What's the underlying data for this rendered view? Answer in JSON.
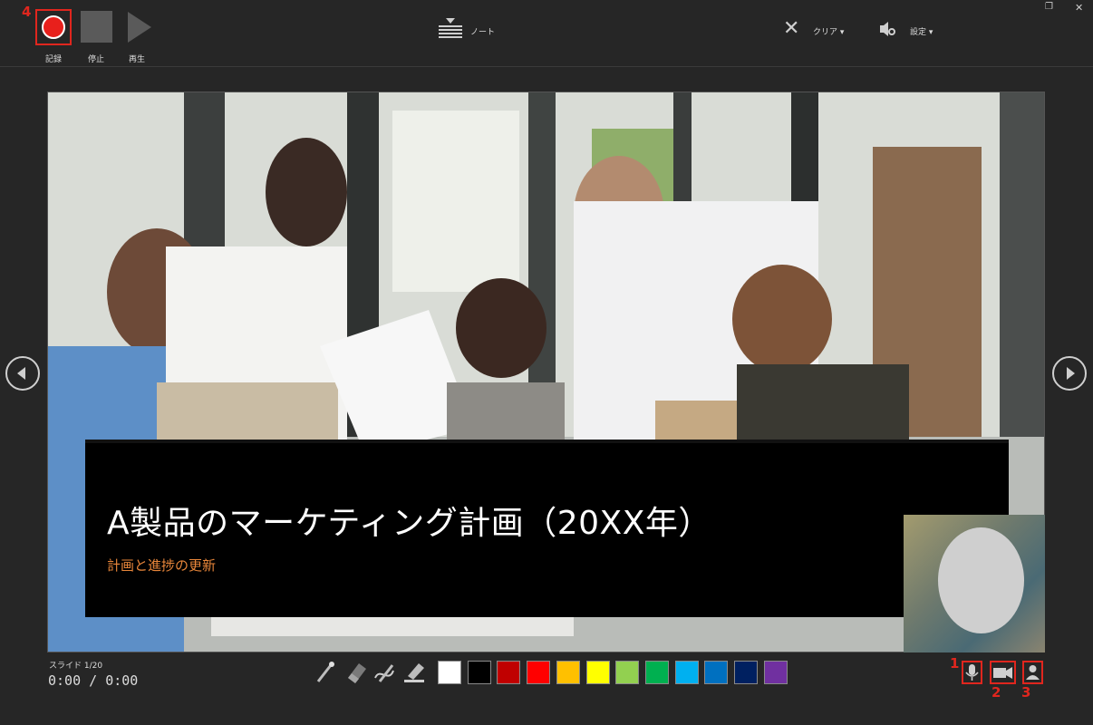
{
  "window": {
    "minimize_glyph": "▔",
    "maximize_glyph": "❐",
    "close_glyph": "✕"
  },
  "toolbar": {
    "record_label": "記録",
    "stop_label": "停止",
    "play_label": "再生",
    "notes_label": "ノート",
    "clear_label": "クリア ▾",
    "settings_label": "設定 ▾"
  },
  "callouts": {
    "record": "4",
    "microphone": "1",
    "camera": "2",
    "camera_preview": "3"
  },
  "slide": {
    "title": "A製品のマーケティング計画（20XX年）",
    "subtitle": "計画と進捗の更新"
  },
  "status": {
    "slide_counter": "スライド 1/20",
    "timer": "0:00 / 0:00"
  },
  "pen_tools": [
    "laser-pointer",
    "eraser",
    "pen",
    "highlighter"
  ],
  "ink_colors": [
    "#ffffff",
    "#000000",
    "#c00000",
    "#ff0000",
    "#ffc000",
    "#ffff00",
    "#92d050",
    "#00b050",
    "#00b0f0",
    "#0070c0",
    "#002060",
    "#7030a0"
  ],
  "colors": {
    "accent_red": "#e0261e",
    "subtitle_orange": "#e8863a",
    "background": "#262626"
  }
}
